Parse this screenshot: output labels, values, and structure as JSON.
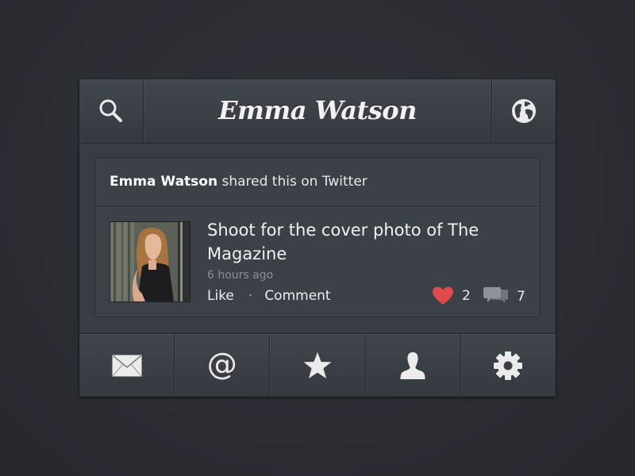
{
  "header": {
    "title": "Emma Watson",
    "left_icon": "search-icon",
    "right_icon": "globe-icon"
  },
  "post": {
    "author": "Emma Watson",
    "shared_suffix": " shared this on Twitter",
    "photo_icon": "profile-photo",
    "text": "Shoot for the cover photo of The Magazine",
    "timestamp": "6 hours ago",
    "like_label": "Like",
    "separator": "·",
    "comment_label": "Comment",
    "likes_count": "2",
    "comments_count": "7"
  },
  "toolbar": {
    "items": [
      {
        "icon": "mail-icon"
      },
      {
        "icon": "at-icon",
        "glyph": "@"
      },
      {
        "icon": "star-icon"
      },
      {
        "icon": "user-icon"
      },
      {
        "icon": "settings-gear-icon"
      }
    ]
  },
  "colors": {
    "background": "#2b2f34",
    "panel": "#383c43",
    "card": "#3c4047",
    "heart": "#e04a4a",
    "text": "#f0f0f0",
    "muted": "#8b9097"
  }
}
